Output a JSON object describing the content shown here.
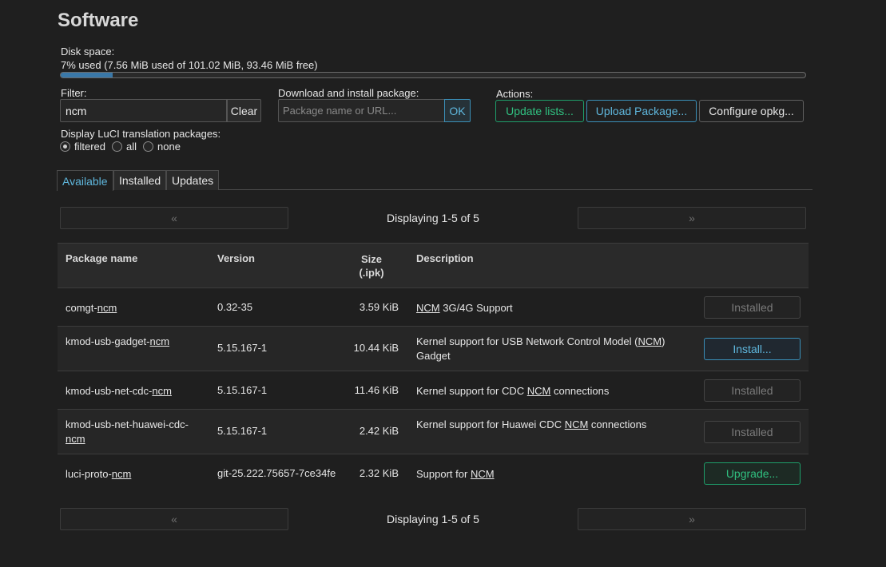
{
  "page_title": "Software",
  "disk": {
    "label": "Disk space:",
    "text": "7% used (7.56 MiB used of 101.02 MiB, 93.46 MiB free)",
    "used_percent": 7
  },
  "filter": {
    "label": "Filter:",
    "value": "ncm",
    "clear_label": "Clear"
  },
  "download": {
    "label": "Download and install package:",
    "placeholder": "Package name or URL...",
    "ok_label": "OK"
  },
  "actions": {
    "label": "Actions:",
    "update_lists": "Update lists...",
    "upload_package": "Upload Package...",
    "configure": "Configure opkg..."
  },
  "translation": {
    "label": "Display LuCI translation packages:",
    "options": [
      "filtered",
      "all",
      "none"
    ],
    "selected": "filtered"
  },
  "tabs": [
    "Available",
    "Installed",
    "Updates"
  ],
  "active_tab": "Available",
  "pager": {
    "prev": "«",
    "next": "»",
    "text": "Displaying 1-5 of 5"
  },
  "table": {
    "headers": {
      "name": "Package name",
      "version": "Version",
      "size_line1": "Size",
      "size_line2": "(.ipk)",
      "description": "Description"
    },
    "rows": [
      {
        "name_pre": "comgt-",
        "name_hl": "ncm",
        "name_post": "",
        "version": "0.32-35",
        "size": "3.59 KiB",
        "desc_pre": "",
        "desc_hl": "NCM",
        "desc_post": " 3G/4G Support",
        "status": "Installed",
        "status_type": "installed"
      },
      {
        "name_pre": "kmod-usb-gadget-",
        "name_hl": "ncm",
        "name_post": "",
        "version": "5.15.167-1",
        "size": "10.44 KiB",
        "desc_pre": "Kernel support for USB Network Control Model (",
        "desc_hl": "NCM",
        "desc_post": ") Gadget",
        "status": "Install...",
        "status_type": "install"
      },
      {
        "name_pre": "kmod-usb-net-cdc-",
        "name_hl": "ncm",
        "name_post": "",
        "version": "5.15.167-1",
        "size": "11.46 KiB",
        "desc_pre": "Kernel support for CDC ",
        "desc_hl": "NCM",
        "desc_post": " connections",
        "status": "Installed",
        "status_type": "installed"
      },
      {
        "name_pre": "kmod-usb-net-huawei-cdc-",
        "name_hl": "ncm",
        "name_post": "",
        "version": "5.15.167-1",
        "size": "2.42 KiB",
        "desc_pre": "Kernel support for Huawei CDC ",
        "desc_hl": "NCM",
        "desc_post": " connections",
        "status": "Installed",
        "status_type": "installed"
      },
      {
        "name_pre": "luci-proto-",
        "name_hl": "ncm",
        "name_post": "",
        "version": "git-25.222.75657-7ce34fe",
        "size": "2.32 KiB",
        "desc_pre": "Support for ",
        "desc_hl": "NCM",
        "desc_post": "",
        "status": "Upgrade...",
        "status_type": "upgrade"
      }
    ]
  }
}
